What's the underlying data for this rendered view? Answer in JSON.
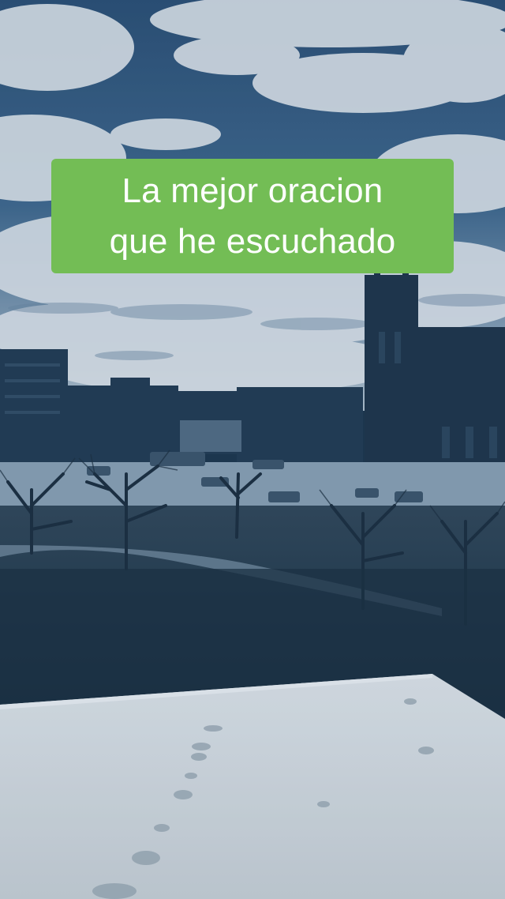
{
  "caption": {
    "text": "La mejor oracion\nque he escuchado"
  },
  "colors": {
    "caption_bg": "#73bd55",
    "caption_text": "#ffffff",
    "sky": "#2c4f73",
    "clouds": "#dde3e8",
    "buildings": "#1f3347",
    "roof_ledge": "#d8dcdd"
  },
  "scene": {
    "description_icons": [
      "cloudy-sky",
      "city-buildings",
      "church-tower",
      "bare-trees",
      "park-lawn",
      "snowy-rooftop-ledge"
    ]
  }
}
